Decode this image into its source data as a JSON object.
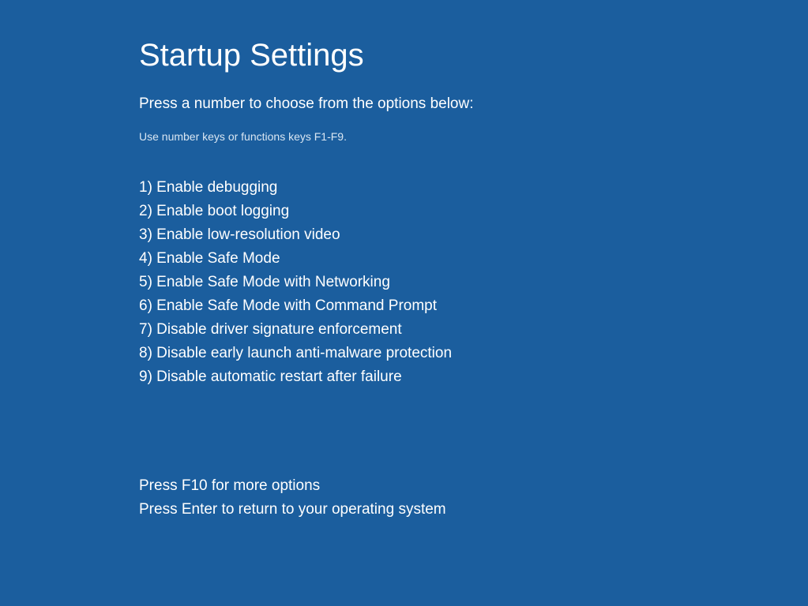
{
  "title": "Startup Settings",
  "subtitle": "Press a number to choose from the options below:",
  "hint": "Use number keys or functions keys F1-F9.",
  "options": [
    "1) Enable debugging",
    "2) Enable boot logging",
    "3) Enable low-resolution video",
    "4) Enable Safe Mode",
    "5) Enable Safe Mode with Networking",
    "6) Enable Safe Mode with Command Prompt",
    "7) Disable driver signature enforcement",
    "8) Disable early launch anti-malware protection",
    "9) Disable automatic restart after failure"
  ],
  "footer": {
    "more_options": "Press F10 for more options",
    "return": "Press Enter to return to your operating system"
  }
}
